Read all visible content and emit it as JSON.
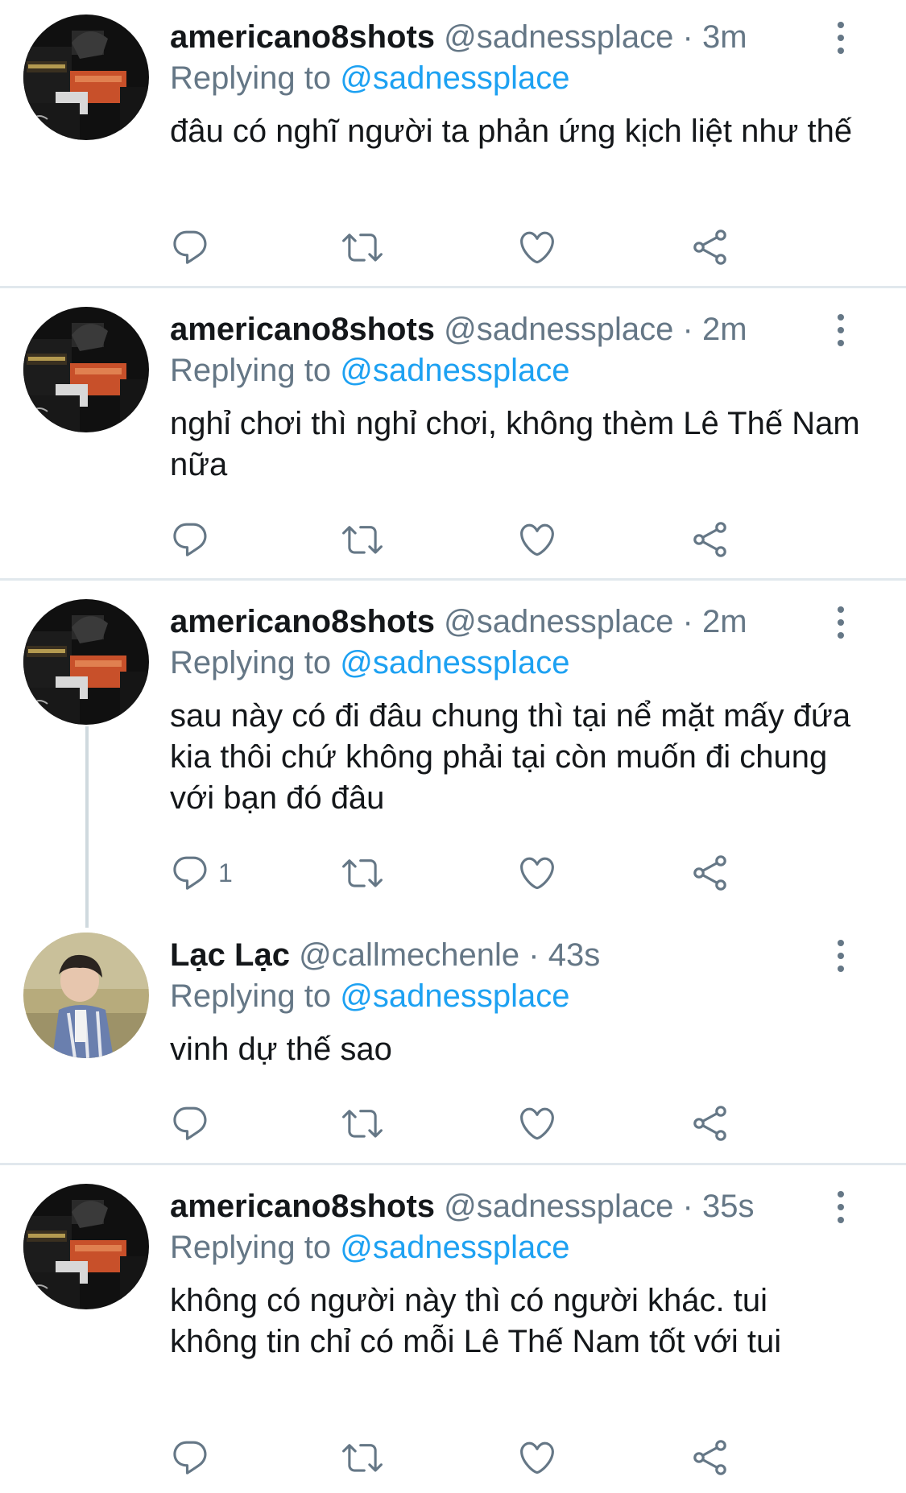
{
  "tweets": [
    {
      "name": "americano8shots",
      "handle": "@sadnessplace",
      "sep": "·",
      "time": "3m",
      "replying_prefix": "Replying to",
      "replying_to": "@sadnessplace",
      "text": "đâu có nghĩ người ta phản ứng kịch liệt như thế",
      "reply_count": "",
      "avatar_icon": "guitar-amp-avatar"
    },
    {
      "name": "americano8shots",
      "handle": "@sadnessplace",
      "sep": "·",
      "time": "2m",
      "replying_prefix": "Replying to",
      "replying_to": "@sadnessplace",
      "text": "nghỉ chơi thì nghỉ chơi, không thèm Lê Thế Nam nữa",
      "reply_count": "",
      "avatar_icon": "guitar-amp-avatar"
    },
    {
      "name": "americano8shots",
      "handle": "@sadnessplace",
      "sep": "·",
      "time": "2m",
      "replying_prefix": "Replying to",
      "replying_to": "@sadnessplace",
      "text": "sau này có đi đâu chung thì tại nể mặt mấy đứa kia thôi chứ không phải tại còn muốn đi chung với bạn đó đâu",
      "reply_count": "1",
      "avatar_icon": "guitar-amp-avatar"
    },
    {
      "name": "Lạc Lạc",
      "handle": "@callmechenle",
      "sep": "·",
      "time": "43s",
      "replying_prefix": "Replying to",
      "replying_to": "@sadnessplace",
      "text": "vinh dự thế sao",
      "reply_count": "",
      "avatar_icon": "person-photo-avatar"
    },
    {
      "name": "americano8shots",
      "handle": "@sadnessplace",
      "sep": "·",
      "time": "35s",
      "replying_prefix": "Replying to",
      "replying_to": "@sadnessplace",
      "text": "không có người này thì có người khác. tui không tin chỉ có mỗi Lê Thế Nam tốt với tui",
      "reply_count": "",
      "avatar_icon": "guitar-amp-avatar"
    }
  ],
  "colors": {
    "text": "#14171a",
    "secondary": "#657786",
    "link": "#1da1f2",
    "divider": "#e1e8ed"
  }
}
